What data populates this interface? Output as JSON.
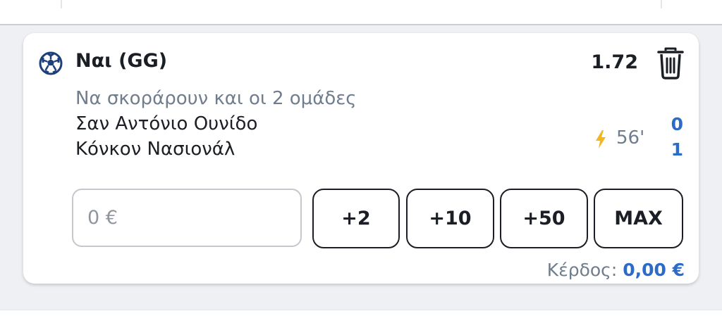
{
  "bet": {
    "sport_icon": "soccer-ball-icon",
    "selection": "Ναι (GG)",
    "odds": "1.72",
    "market": "Να σκοράρουν και οι 2 ομάδες",
    "home_team": "Σαν Αντόνιο Ουνίδο",
    "away_team": "Κόνκον Νασιονάλ",
    "live_minute": "56'",
    "home_score": "0",
    "away_score": "1"
  },
  "stake": {
    "value": "",
    "placeholder": "0 €"
  },
  "quick_stakes": [
    "+2",
    "+10",
    "+50",
    "MAX"
  ],
  "winnings": {
    "label": "Κέρδος:",
    "amount": "0,00 €"
  },
  "colors": {
    "accent": "#2c6bc7",
    "text": "#1b1e24",
    "muted": "#6f7d8c",
    "live": "#f2b71e"
  }
}
